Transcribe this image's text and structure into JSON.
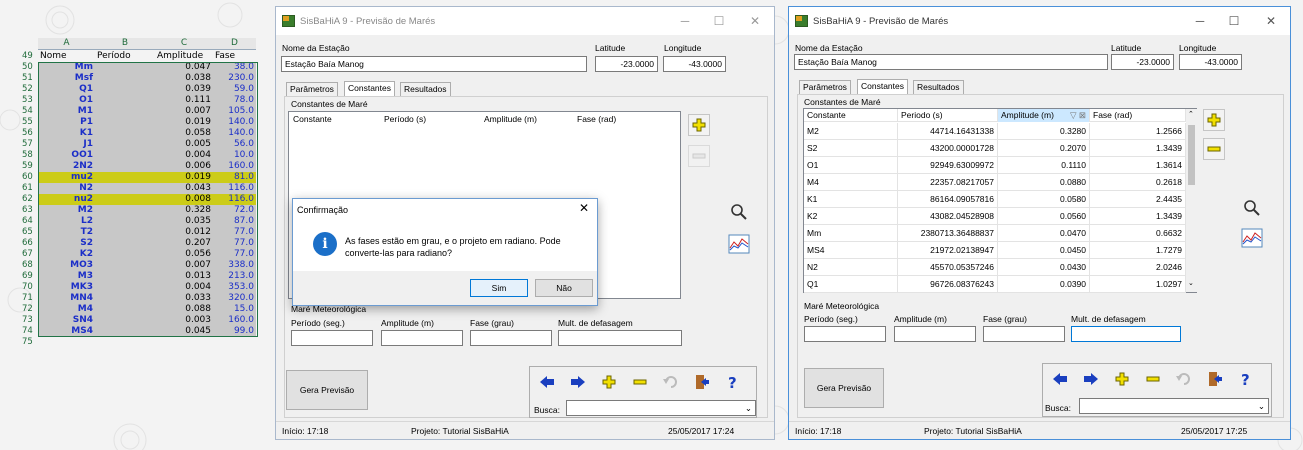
{
  "sheet": {
    "col_headers": [
      "A",
      "B",
      "C",
      "D"
    ],
    "header_row": {
      "num": "49",
      "a": "Nome",
      "b": "Período",
      "c": "Amplitude",
      "d": "Fase"
    },
    "rows": [
      {
        "num": "50",
        "a": "Mm",
        "c": "0.047",
        "d": "38.0"
      },
      {
        "num": "51",
        "a": "Msf",
        "c": "0.038",
        "d": "230.0"
      },
      {
        "num": "52",
        "a": "Q1",
        "c": "0.039",
        "d": "59.0"
      },
      {
        "num": "53",
        "a": "O1",
        "c": "0.111",
        "d": "78.0"
      },
      {
        "num": "54",
        "a": "M1",
        "c": "0.007",
        "d": "105.0"
      },
      {
        "num": "55",
        "a": "P1",
        "c": "0.019",
        "d": "140.0"
      },
      {
        "num": "56",
        "a": "K1",
        "c": "0.058",
        "d": "140.0"
      },
      {
        "num": "57",
        "a": "J1",
        "c": "0.005",
        "d": "56.0"
      },
      {
        "num": "58",
        "a": "OO1",
        "c": "0.004",
        "d": "10.0"
      },
      {
        "num": "59",
        "a": "2N2",
        "c": "0.006",
        "d": "160.0"
      },
      {
        "num": "60",
        "a": "mu2",
        "c": "0.019",
        "d": "81.0"
      },
      {
        "num": "61",
        "a": "N2",
        "c": "0.043",
        "d": "116.0"
      },
      {
        "num": "62",
        "a": "nu2",
        "c": "0.008",
        "d": "116.0"
      },
      {
        "num": "63",
        "a": "M2",
        "c": "0.328",
        "d": "72.0"
      },
      {
        "num": "64",
        "a": "L2",
        "c": "0.035",
        "d": "87.0"
      },
      {
        "num": "65",
        "a": "T2",
        "c": "0.012",
        "d": "77.0"
      },
      {
        "num": "66",
        "a": "S2",
        "c": "0.207",
        "d": "77.0"
      },
      {
        "num": "67",
        "a": "K2",
        "c": "0.056",
        "d": "77.0"
      },
      {
        "num": "68",
        "a": "MO3",
        "c": "0.007",
        "d": "338.0"
      },
      {
        "num": "69",
        "a": "M3",
        "c": "0.013",
        "d": "213.0"
      },
      {
        "num": "70",
        "a": "MK3",
        "c": "0.004",
        "d": "353.0"
      },
      {
        "num": "71",
        "a": "MN4",
        "c": "0.033",
        "d": "320.0"
      },
      {
        "num": "72",
        "a": "M4",
        "c": "0.088",
        "d": "15.0"
      },
      {
        "num": "73",
        "a": "SN4",
        "c": "0.003",
        "d": "160.0"
      },
      {
        "num": "74",
        "a": "MS4",
        "c": "0.045",
        "d": "99.0"
      }
    ],
    "last_row": "75",
    "highlight_rows": [
      10,
      12
    ],
    "colors": {
      "selection": "#c8c8c8",
      "highlight": "#cccc18",
      "name_text": "#1b2ec8"
    }
  },
  "win1": {
    "title": "SisBaHiA 9 - Previsão de Marés",
    "station_label": "Nome da Estação",
    "station_value": "Estação Baía Manog",
    "lat_label": "Latitude",
    "lat_value": "-23.0000",
    "lon_label": "Longitude",
    "lon_value": "-43.0000",
    "tabs": [
      "Parâmetros",
      "Constantes",
      "Resultados"
    ],
    "group_label": "Constantes de Maré",
    "columns": [
      "Constante",
      "Período (s)",
      "Amplitude (m)",
      "Fase (rad)"
    ],
    "met_label": "Maré Meteorológica",
    "met_fields": [
      "Período (seg.)",
      "Amplitude (m)",
      "Fase (grau)",
      "Mult. de defasagem"
    ],
    "gera_label": "Gera Previsão",
    "busca_label": "Busca:",
    "status": {
      "inicio": "Início: 17:18",
      "projeto": "Projeto: Tutorial SisBaHiA",
      "data": "25/05/2017 17:24"
    },
    "dialog": {
      "title": "Confirmação",
      "message": "As fases estão em grau, e o projeto em radiano. Pode converte-las para radiano?",
      "yes": "Sim",
      "no": "Não"
    }
  },
  "win2": {
    "title": "SisBaHiA 9 - Previsão de Marés",
    "station_label": "Nome da Estação",
    "station_value": "Estação Baía Manog",
    "lat_label": "Latitude",
    "lat_value": "-23.0000",
    "lon_label": "Longitude",
    "lon_value": "-43.0000",
    "tabs": [
      "Parâmetros",
      "Constantes",
      "Resultados"
    ],
    "group_label": "Constantes de Maré",
    "columns": [
      "Constante",
      "Periodo (s)",
      "Amplitude (m)",
      "Fase (rad)"
    ],
    "rows": [
      {
        "c": "M2",
        "p": "44714.16431338",
        "a": "0.3280",
        "f": "1.2566"
      },
      {
        "c": "S2",
        "p": "43200.00001728",
        "a": "0.2070",
        "f": "1.3439"
      },
      {
        "c": "O1",
        "p": "92949.63009972",
        "a": "0.1110",
        "f": "1.3614"
      },
      {
        "c": "M4",
        "p": "22357.08217057",
        "a": "0.0880",
        "f": "0.2618"
      },
      {
        "c": "K1",
        "p": "86164.09057816",
        "a": "0.0580",
        "f": "2.4435"
      },
      {
        "c": "K2",
        "p": "43082.04528908",
        "a": "0.0560",
        "f": "1.3439"
      },
      {
        "c": "Mm",
        "p": "2380713.36488837",
        "a": "0.0470",
        "f": "0.6632"
      },
      {
        "c": "MS4",
        "p": "21972.02138947",
        "a": "0.0450",
        "f": "1.7279"
      },
      {
        "c": "N2",
        "p": "45570.05357246",
        "a": "0.0430",
        "f": "2.0246"
      },
      {
        "c": "Q1",
        "p": "96726.08376243",
        "a": "0.0390",
        "f": "1.0297"
      }
    ],
    "met_label": "Maré Meteorológica",
    "met_fields": [
      "Período (seg.)",
      "Amplitude (m)",
      "Fase (grau)",
      "Mult. de defasagem"
    ],
    "gera_label": "Gera Previsão",
    "busca_label": "Busca:",
    "status": {
      "inicio": "Início: 17:18",
      "projeto": "Projeto: Tutorial SisBaHiA",
      "data": "25/05/2017 17:25"
    }
  },
  "colors": {
    "arrow_blue": "#1a3fbf",
    "plus_yellow": "#f2e000",
    "minus_yellow": "#f2e000",
    "info_blue": "#1b6fc8"
  }
}
